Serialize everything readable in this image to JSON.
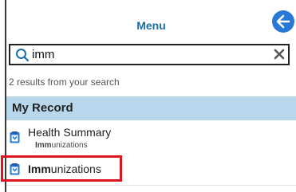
{
  "menu": {
    "title": "Menu",
    "back_icon": "arrow-left-icon"
  },
  "search": {
    "value": "imm",
    "search_icon": "search-icon",
    "clear_icon": "close-icon",
    "results_text": "2 results from your search"
  },
  "section": {
    "title": "My Record",
    "color": "#b8d7ec"
  },
  "results": [
    {
      "title": "Health Summary",
      "sub_match": "Imm",
      "sub_rest": "unizations",
      "icon": "document-icon"
    },
    {
      "title_match": "Imm",
      "title_rest": "unizations",
      "icon": "document-icon"
    }
  ],
  "colors": {
    "accent": "#2a78d6",
    "title": "#1a6fa8",
    "highlight": "#e0141e"
  }
}
